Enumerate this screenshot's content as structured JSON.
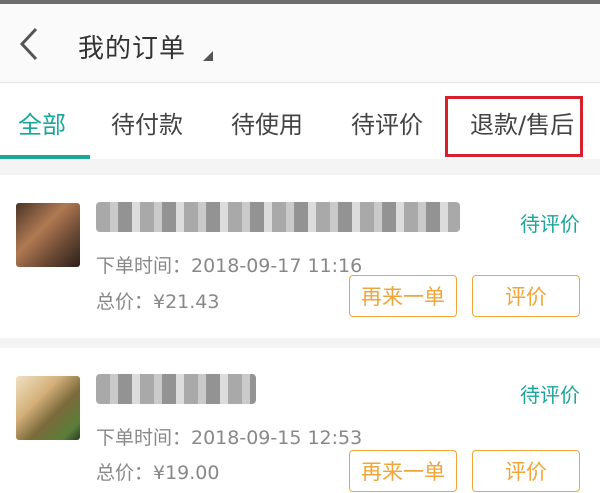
{
  "header": {
    "title": "我的订单",
    "back_icon": "chevron-left-icon",
    "title_caret_icon": "caret-down-icon"
  },
  "tabs": [
    {
      "label": "全部",
      "active": true
    },
    {
      "label": "待付款",
      "active": false
    },
    {
      "label": "待使用",
      "active": false
    },
    {
      "label": "待评价",
      "active": false
    },
    {
      "label": "退款/售后",
      "active": false,
      "highlighted": true
    }
  ],
  "orders": [
    {
      "status": "待评价",
      "order_time": "下单时间：2018-09-17 11:16",
      "price": "总价：¥21.43",
      "buy_again_label": "再来一单",
      "rate_label": "评价"
    },
    {
      "status": "待评价",
      "order_time": "下单时间：2018-09-15 12:53",
      "price": "总价：¥19.00",
      "buy_again_label": "再来一单",
      "rate_label": "评价"
    }
  ],
  "colors": {
    "accent": "#1aa79a",
    "button": "#f0a53a",
    "highlight": "#d8202c"
  }
}
